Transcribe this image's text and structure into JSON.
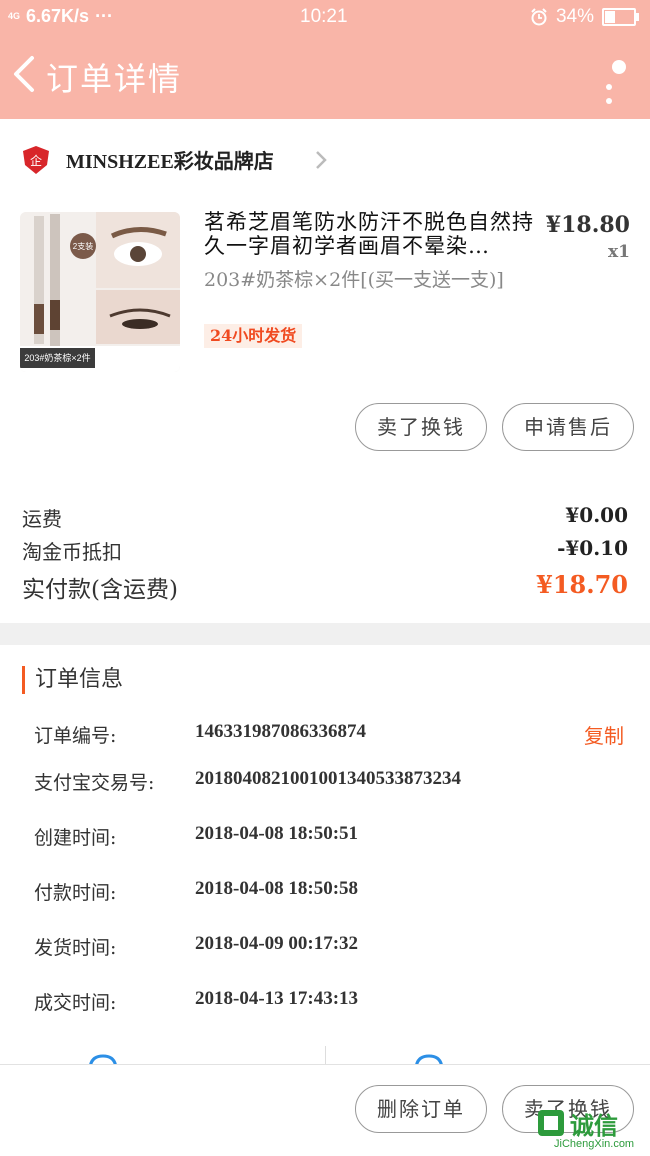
{
  "status_bar": {
    "network": "4G",
    "speed": "6.67K/s",
    "dots": "···",
    "time": "10:21",
    "battery": "34%",
    "battery_level": 0.34
  },
  "nav": {
    "title": "订单详情"
  },
  "store": {
    "name": "MINSHZEE彩妆品牌店"
  },
  "product": {
    "title": "茗希芝眉笔防水防汗不脱色自然持久一字眉初学者画眉不晕染…",
    "price": "¥18.80",
    "qty": "x1",
    "sku": "203#奶茶棕×2件[(买一支送一支)]",
    "badge": "24小时发货",
    "image_caption_count": "2支装",
    "image_caption": "203#奶茶棕×2件"
  },
  "actions": {
    "sell_label": "卖了换钱",
    "after_sale_label": "申请售后"
  },
  "costs": {
    "shipping_label": "运费",
    "shipping_value": "¥0.00",
    "coin_label": "淘金币抵扣",
    "coin_value": "-¥0.10",
    "paid_label": "实付款(含运费)",
    "paid_value": "¥18.70"
  },
  "order_info": {
    "title": "订单信息",
    "copy_label": "复制",
    "rows": [
      {
        "label": "订单编号:",
        "value": "146331987086336874"
      },
      {
        "label": "支付宝交易号:",
        "value": "2018040821001001340533873234"
      },
      {
        "label": "创建时间:",
        "value": "2018-04-08 18:50:51"
      },
      {
        "label": "付款时间:",
        "value": "2018-04-08 18:50:58"
      },
      {
        "label": "发货时间:",
        "value": "2018-04-09 00:17:32"
      },
      {
        "label": "成交时间:",
        "value": "2018-04-13 17:43:13"
      }
    ]
  },
  "bottom": {
    "delete_label": "删除订单",
    "sell_label": "卖了换钱"
  },
  "watermark": {
    "brand": "诚信",
    "url": "JiChengXin.com"
  },
  "colors": {
    "header": "#f9b5a8",
    "accent": "#f45b22"
  }
}
